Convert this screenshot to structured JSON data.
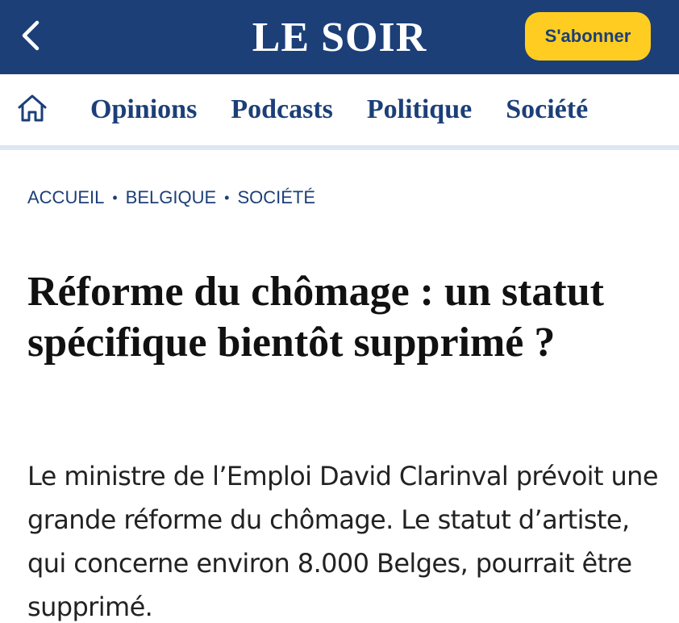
{
  "header": {
    "back_icon": "chevron-left-icon",
    "brand": "LE SOIR",
    "subscribe_label": "S'abonner",
    "colors": {
      "header_bg": "#1c3f78",
      "subscribe_bg": "#ffcd21",
      "subscribe_text": "#1c3f78"
    }
  },
  "nav": {
    "home_icon": "home-icon",
    "items": [
      {
        "label": "Opinions"
      },
      {
        "label": "Podcasts"
      },
      {
        "label": "Politique"
      },
      {
        "label": "Société"
      }
    ]
  },
  "breadcrumb": {
    "items": [
      {
        "label": "ACCUEIL"
      },
      {
        "label": "BELGIQUE"
      },
      {
        "label": "SOCIÉTÉ"
      }
    ],
    "separator": "•"
  },
  "article": {
    "headline": "Réforme du chômage : un statut spécifique bientôt supprimé ?",
    "lead": "Le ministre de l’Emploi David Clarinval prévoit une grande réforme du chômage. Le statut d’artiste, qui concerne environ 8.000 Belges, pourrait être supprimé."
  }
}
